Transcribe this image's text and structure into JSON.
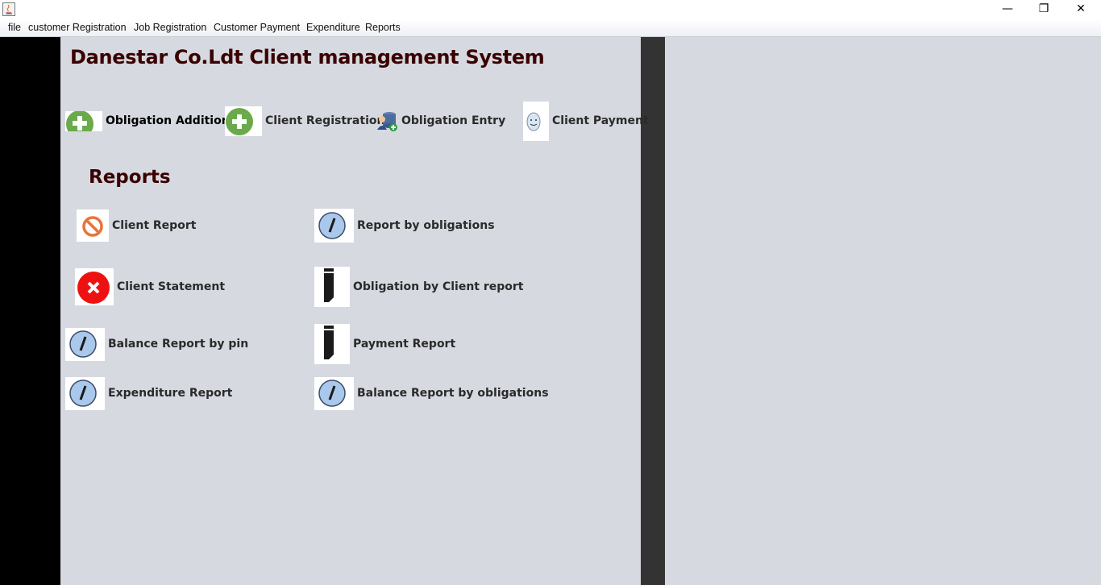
{
  "window": {
    "controls": {
      "minimize": "—",
      "restore": "❐",
      "close": "✕"
    }
  },
  "menubar": {
    "items": [
      "file",
      "customer Registration",
      "Job Registration",
      "Customer Payment",
      "Expenditure",
      "Reports"
    ]
  },
  "header": {
    "title": "Danestar Co.Ldt Client management System"
  },
  "quick_actions": [
    {
      "label": "Obligation  Addition",
      "icon": "plus-circle-icon"
    },
    {
      "label": "Client Registration",
      "icon": "plus-circle-icon"
    },
    {
      "label": "Obligation  Entry",
      "icon": "user-database-icon"
    },
    {
      "label": "Client Payment",
      "icon": "smiley-face-icon"
    }
  ],
  "reports": {
    "title": "Reports",
    "items": [
      {
        "label": "Client  Report",
        "icon": "no-entry-icon"
      },
      {
        "label": "Report by obligations",
        "icon": "pen-circle-icon"
      },
      {
        "label": "Client  Statement",
        "icon": "red-x-icon"
      },
      {
        "label": "Obligation by Client  report",
        "icon": "black-pen-icon"
      },
      {
        "label": "Balance Report by pin",
        "icon": "pen-circle-icon"
      },
      {
        "label": "Payment Report",
        "icon": "black-pen-icon"
      },
      {
        "label": "Expenditure  Report",
        "icon": "pen-circle-icon"
      },
      {
        "label": "Balance  Report by obligations",
        "icon": "pen-circle-icon"
      }
    ]
  },
  "colors": {
    "panel": "#d6d9e0",
    "divider": "#333333",
    "left_strip": "#000000",
    "title_text": "#3a0000",
    "plus_green": "#6aaa4a",
    "red_x": "#ee1111",
    "no_entry_orange": "#e8743a",
    "pen_circle": "#a9c8ec"
  }
}
